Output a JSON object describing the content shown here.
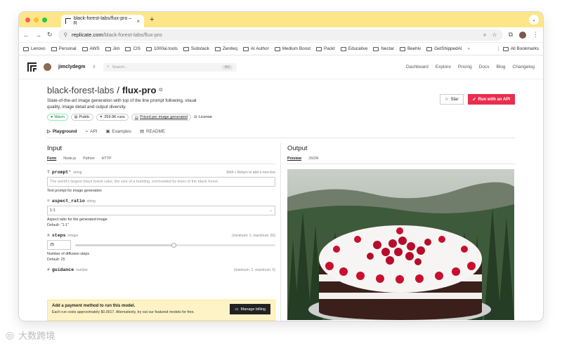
{
  "browser": {
    "tab_title": "black-forest-labs/flux-pro – R",
    "url_host": "replicate.com",
    "url_path": "/black-forest-labs/flux-pro",
    "bookmarks": [
      "Lenovo",
      "Personal",
      "AWS",
      "Jim",
      "CIS",
      "1000ai.tools",
      "Substack",
      "Zeniteq",
      "AI Author",
      "Medium Boost",
      "Packt",
      "Educative",
      "Nectar",
      "Beehiv",
      "GetShippedAI"
    ],
    "all_bookmarks": "All Bookmarks",
    "overflow": "»"
  },
  "site": {
    "username": "jimclydegm",
    "search_placeholder": "Search...",
    "search_kbd": "⌘K",
    "nav": [
      "Dashboard",
      "Explore",
      "Pricing",
      "Docs",
      "Blog",
      "Changelog"
    ]
  },
  "model": {
    "owner": "black-forest-labs",
    "separator": "/",
    "name": "flux-pro",
    "description": "State-of-the-art image generation with top of the line prompt following, visual quality, image detail and output diversity.",
    "badges": {
      "warm": "Warm",
      "public": "Public",
      "runs": "259.9K runs",
      "priced": "Priced per image generated",
      "license": "License"
    },
    "star_label": "Star",
    "run_api_label": "Run with an API",
    "tabs": [
      "Playground",
      "API",
      "Examples",
      "README"
    ]
  },
  "input": {
    "title": "Input",
    "subtabs": [
      "Form",
      "Node.js",
      "Python",
      "HTTP"
    ],
    "prompt": {
      "label": "prompt",
      "required": "*",
      "type": "string",
      "hint": "Shift + Return to add a new line",
      "placeholder": "The world's largest black forest cake, the size of a building, surrounded by trees of the black forest",
      "desc": "Text prompt for image generation"
    },
    "aspect_ratio": {
      "label": "aspect_ratio",
      "type": "string",
      "value": "1:1",
      "desc": "Aspect ratio for the generated image",
      "default": "Default: \"1:1\""
    },
    "steps": {
      "label": "steps",
      "type": "integer",
      "range": "(minimum: 1, maximum: 50)",
      "value": "25",
      "fraction": 0.49,
      "desc": "Number of diffusion steps",
      "default": "Default: 25"
    },
    "guidance": {
      "label": "guidance",
      "type": "number",
      "range": "(minimum: 2, maximum: 5)"
    }
  },
  "payment": {
    "title": "Add a payment method to run this model.",
    "sub": "Each run costs approximately $0.0017. Alternatively, try out our featured models for free.",
    "button": "Manage billing"
  },
  "output": {
    "title": "Output",
    "subtabs": [
      "Preview",
      "JSON"
    ]
  },
  "watermark": "大数跨境",
  "colors": {
    "tabbar": "#fde68a",
    "run_button": "#ea2e4e",
    "warm": "#15803d",
    "payment_bg": "#fef3c7"
  }
}
